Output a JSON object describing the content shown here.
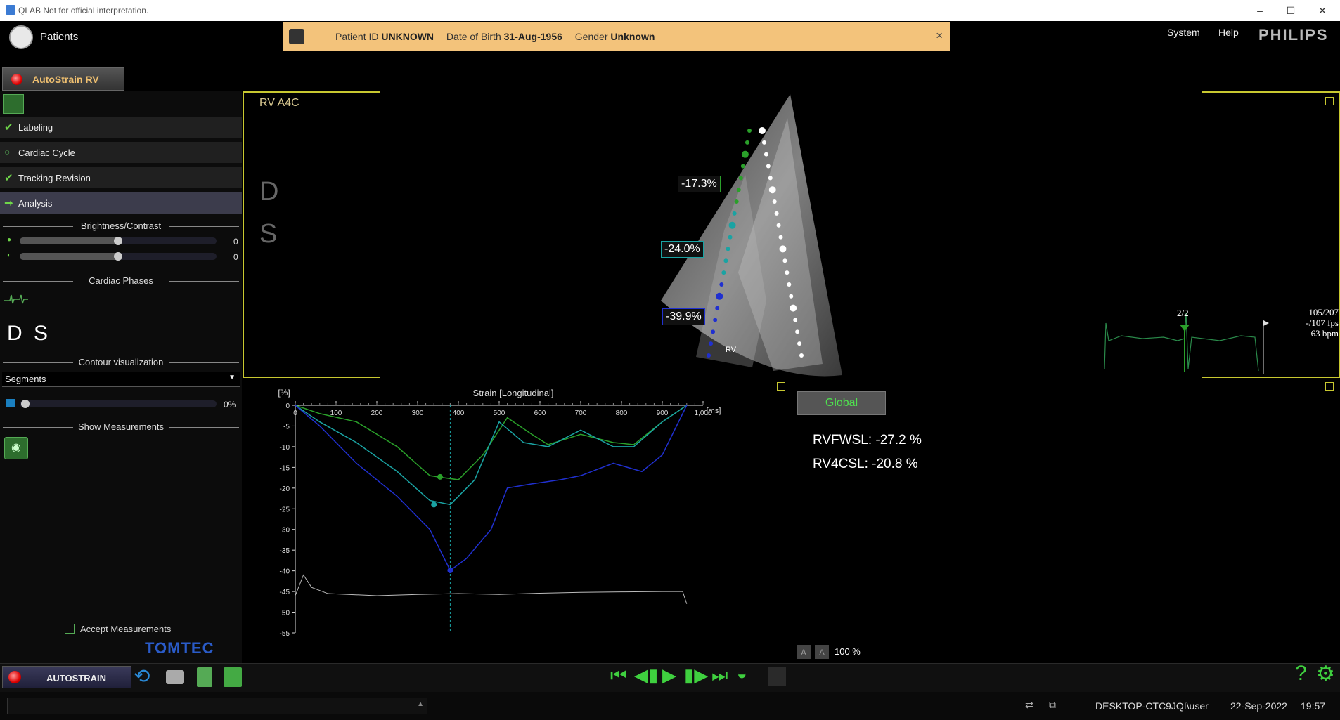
{
  "window": {
    "title": "QLAB Not for official interpretation."
  },
  "header": {
    "patients_label": "Patients",
    "patient": {
      "id_label": "Patient ID",
      "id_value": "UNKNOWN",
      "dob_label": "Date of Birth",
      "dob_value": "31-Aug-1956",
      "gender_label": "Gender",
      "gender_value": "Unknown",
      "close": "×"
    },
    "menu": {
      "system": "System",
      "help": "Help"
    },
    "brand": "PHILIPS"
  },
  "module_tab": {
    "label": "AutoStrain RV"
  },
  "workflow_steps": [
    {
      "label": "Labeling",
      "state": "done"
    },
    {
      "label": "Cardiac Cycle",
      "state": "pending"
    },
    {
      "label": "Tracking Revision",
      "state": "done"
    },
    {
      "label": "Analysis",
      "state": "active"
    }
  ],
  "brightness": {
    "title": "Brightness/Contrast",
    "brightness_value": "0",
    "contrast_value": "0",
    "brightness_level": 0.5,
    "contrast_level": 0.5
  },
  "phases": {
    "title": "Cardiac Phases",
    "d": "D",
    "s": "S"
  },
  "contour": {
    "title": "Contour visualization",
    "selected": "Segments",
    "opacity_value": "0%",
    "opacity_level": 0
  },
  "measurements": {
    "title": "Show Measurements",
    "accept_label": "Accept Measurements"
  },
  "logo": "TOMTEC",
  "image_view": {
    "label": "RV A4C",
    "overlay_d": "D",
    "overlay_s": "S",
    "segment_labels": [
      "-17.3%",
      "-24.0%",
      "-39.9%"
    ],
    "rv_marker": "RV",
    "frame_counter": "2/2",
    "frame_info": [
      "105/207",
      "-/107 fps",
      "63 bpm"
    ]
  },
  "chart_data": {
    "type": "line",
    "title": "Strain [Longitudinal]",
    "ylabel": "[%]",
    "xlabel": "[ms]",
    "xlim": [
      0,
      1000
    ],
    "ylim": [
      -55,
      0
    ],
    "xticks": [
      "0",
      "100",
      "200",
      "300",
      "400",
      "500",
      "600",
      "700",
      "800",
      "900",
      "1,000"
    ],
    "yticks": [
      "0",
      "-5",
      "-10",
      "-15",
      "-20",
      "-25",
      "-30",
      "-35",
      "-40",
      "-45",
      "-50",
      "-55"
    ],
    "series": [
      {
        "color": "#2aa02a",
        "x": [
          0,
          60,
          150,
          250,
          330,
          400,
          460,
          520,
          580,
          620,
          700,
          780,
          830,
          900,
          960
        ],
        "y": [
          0,
          -2,
          -4,
          -10,
          -17,
          -18,
          -12,
          -3,
          -7,
          -9.5,
          -7,
          -9,
          -9.5,
          -4,
          0
        ],
        "marker": {
          "x": 355,
          "y": -17.3
        }
      },
      {
        "color": "#1aa3a3",
        "x": [
          0,
          60,
          150,
          250,
          330,
          380,
          440,
          500,
          560,
          620,
          700,
          780,
          830,
          900,
          960
        ],
        "y": [
          0,
          -4,
          -9,
          -16,
          -23,
          -24,
          -18,
          -4,
          -9,
          -10,
          -6,
          -10,
          -10,
          -4,
          0
        ],
        "marker": {
          "x": 340,
          "y": -24.0
        }
      },
      {
        "color": "#2030d0",
        "x": [
          0,
          60,
          150,
          250,
          330,
          380,
          420,
          480,
          520,
          580,
          650,
          700,
          780,
          850,
          900,
          960
        ],
        "y": [
          0,
          -5,
          -14,
          -22,
          -30,
          -39.9,
          -37,
          -30,
          -20,
          -19,
          -18,
          -17,
          -14,
          -16,
          -12,
          0
        ],
        "marker": {
          "x": 380,
          "y": -39.9
        }
      }
    ],
    "ecg_level": -46
  },
  "results": {
    "tab": "Global",
    "lines": [
      "RVFWSL: -27.2 %",
      "RV4CSL: -20.8 %"
    ],
    "zoom": "100 %",
    "font_a1": "A",
    "font_a2": "A"
  },
  "toolbar": {
    "autostrain": "AUTOSTRAIN"
  },
  "status": {
    "user": "DESKTOP-CTC9JQI\\user",
    "date": "22-Sep-2022",
    "time": "19:57"
  }
}
